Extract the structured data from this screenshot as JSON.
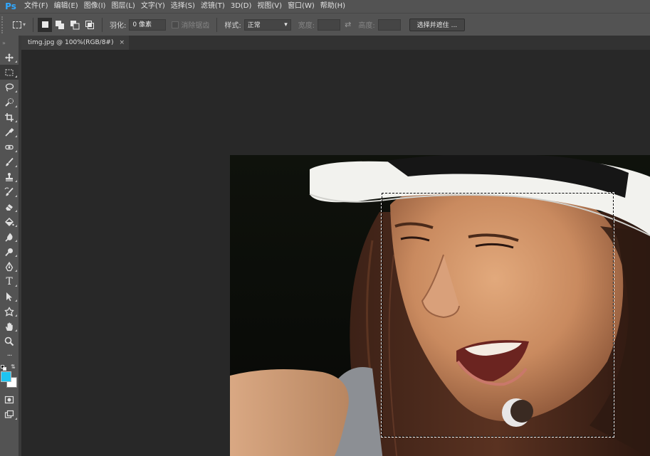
{
  "app": {
    "logo": "Ps",
    "menu": [
      "文件(F)",
      "编辑(E)",
      "图像(I)",
      "图层(L)",
      "文字(Y)",
      "选择(S)",
      "滤镜(T)",
      "3D(D)",
      "视图(V)",
      "窗口(W)",
      "帮助(H)"
    ]
  },
  "options": {
    "feather_label": "羽化:",
    "feather_value": "0 像素",
    "antialias_label": "消除锯齿",
    "style_label": "样式:",
    "style_value": "正常",
    "width_label": "宽度:",
    "height_label": "高度:",
    "select_mask_label": "选择并遮住 ..."
  },
  "document": {
    "tab_title": "timg.jpg @ 100%(RGB/8#)",
    "close_glyph": "×"
  },
  "colors": {
    "foreground": "#1ec4f0",
    "background": "#ffffff",
    "accent": "#31a8ff"
  },
  "tools": [
    "move-tool",
    "rectangular-marquee-tool",
    "lasso-tool",
    "quick-selection-tool",
    "crop-tool",
    "eyedropper-tool",
    "spot-healing-tool",
    "brush-tool",
    "clone-stamp-tool",
    "history-brush-tool",
    "eraser-tool",
    "paint-bucket-tool",
    "blur-tool",
    "dodge-tool",
    "pen-tool",
    "type-tool",
    "path-selection-tool",
    "custom-shape-tool",
    "hand-tool",
    "zoom-tool",
    "more-tools",
    "quick-mask-mode",
    "screen-mode"
  ],
  "tool_glyphs": {
    "type": "T",
    "more": "···"
  }
}
